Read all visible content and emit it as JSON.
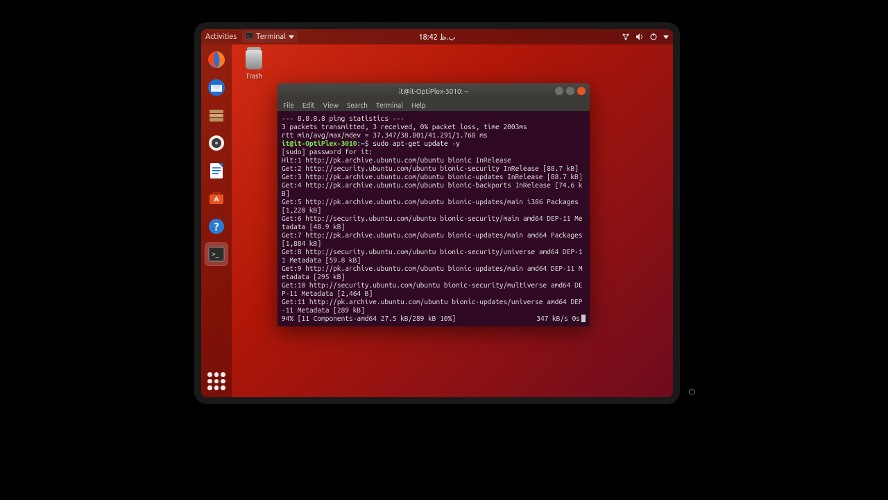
{
  "topbar": {
    "activities": "Activities",
    "app_name": "Terminal",
    "clock": "18:42 ب.ظ"
  },
  "desktop": {
    "trash_label": "Trash"
  },
  "dock": {
    "items": [
      {
        "name": "firefox-icon"
      },
      {
        "name": "thunderbird-icon"
      },
      {
        "name": "files-icon"
      },
      {
        "name": "rhythmbox-icon"
      },
      {
        "name": "libreoffice-writer-icon"
      },
      {
        "name": "ubuntu-software-icon"
      },
      {
        "name": "help-icon"
      },
      {
        "name": "terminal-icon"
      }
    ]
  },
  "terminal": {
    "title": "it@it-OptiPlex-3010: ~",
    "menus": [
      "File",
      "Edit",
      "View",
      "Search",
      "Terminal",
      "Help"
    ],
    "prompt_user": "it@it-OptiPlex-3010",
    "prompt_path": "~",
    "command": "sudo apt-get update -y",
    "lines": [
      "--- 8.8.8.8 ping statistics ---",
      "3 packets transmitted, 3 received, 0% packet loss, time 2003ms",
      "rtt min/avg/max/mdev = 37.347/38.801/41.291/1.768 ms",
      "__PROMPT__",
      "[sudo] password for it:",
      "Hit:1 http://pk.archive.ubuntu.com/ubuntu bionic InRelease",
      "Get:2 http://security.ubuntu.com/ubuntu bionic-security InRelease [88.7 kB]",
      "Get:3 http://pk.archive.ubuntu.com/ubuntu bionic-updates InRelease [88.7 kB]",
      "Get:4 http://pk.archive.ubuntu.com/ubuntu bionic-backports InRelease [74.6 kB]",
      "Get:5 http://pk.archive.ubuntu.com/ubuntu bionic-updates/main i386 Packages [1,220 kB]",
      "Get:6 http://security.ubuntu.com/ubuntu bionic-security/main amd64 DEP-11 Metadata [48.9 kB]",
      "Get:7 http://pk.archive.ubuntu.com/ubuntu bionic-updates/main amd64 Packages [1,884 kB]",
      "Get:8 http://security.ubuntu.com/ubuntu bionic-security/universe amd64 DEP-11 Metadata [59.8 kB]",
      "Get:9 http://pk.archive.ubuntu.com/ubuntu bionic-updates/main amd64 DEP-11 Metadata [295 kB]",
      "Get:10 http://security.ubuntu.com/ubuntu bionic-security/multiverse amd64 DEP-11 Metadata [2,464 B]",
      "Get:11 http://pk.archive.ubuntu.com/ubuntu bionic-updates/universe amd64 DEP-11 Metadata [289 kB]"
    ],
    "progress_left": "94% [11 Components-amd64 27.5 kB/289 kB 10%]",
    "progress_right": "347 kB/s 0s"
  }
}
